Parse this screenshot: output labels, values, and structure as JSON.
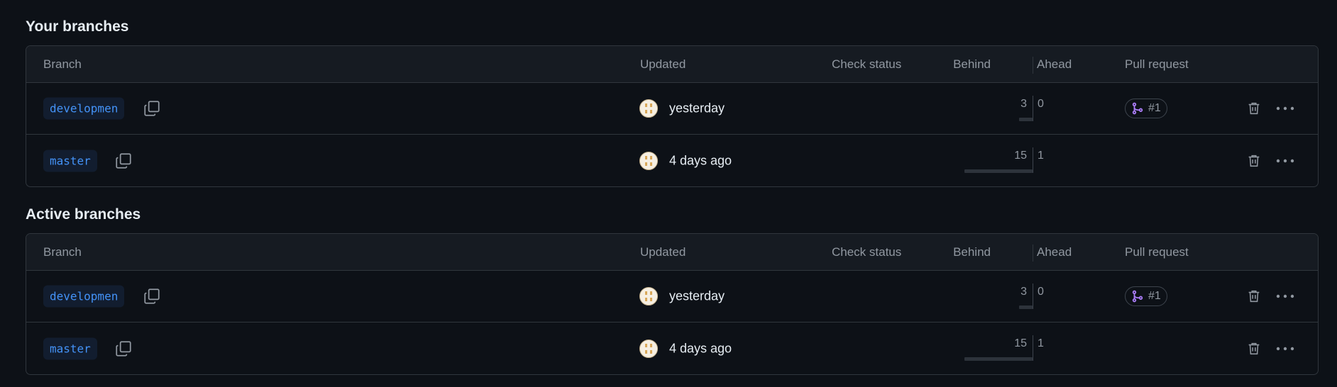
{
  "sections": [
    {
      "title": "Your branches",
      "headers": {
        "branch": "Branch",
        "updated": "Updated",
        "check_status": "Check status",
        "behind": "Behind",
        "ahead": "Ahead",
        "pull_request": "Pull request"
      },
      "rows": [
        {
          "branch": "developmen",
          "updated": "yesterday",
          "behind": "3",
          "ahead": "0",
          "behind_fraction": 0.2,
          "pull_request": "#1"
        },
        {
          "branch": "master",
          "updated": "4 days ago",
          "behind": "15",
          "ahead": "1",
          "behind_fraction": 1.0,
          "pull_request": ""
        }
      ]
    },
    {
      "title": "Active branches",
      "headers": {
        "branch": "Branch",
        "updated": "Updated",
        "check_status": "Check status",
        "behind": "Behind",
        "ahead": "Ahead",
        "pull_request": "Pull request"
      },
      "rows": [
        {
          "branch": "developmen",
          "updated": "yesterday",
          "behind": "3",
          "ahead": "0",
          "behind_fraction": 0.2,
          "pull_request": "#1"
        },
        {
          "branch": "master",
          "updated": "4 days ago",
          "behind": "15",
          "ahead": "1",
          "behind_fraction": 1.0,
          "pull_request": ""
        }
      ]
    }
  ],
  "icons": {
    "copy": "copy-icon",
    "pull_request": "git-pull-request-icon",
    "delete": "trash-icon",
    "more": "kebab-horizontal-icon"
  },
  "colors": {
    "background": "#0d1117",
    "header_background": "#161b22",
    "border": "#30363d",
    "branch_link": "#4493f8",
    "pr_open": "#ab7df8",
    "muted_text": "#9198a1"
  }
}
